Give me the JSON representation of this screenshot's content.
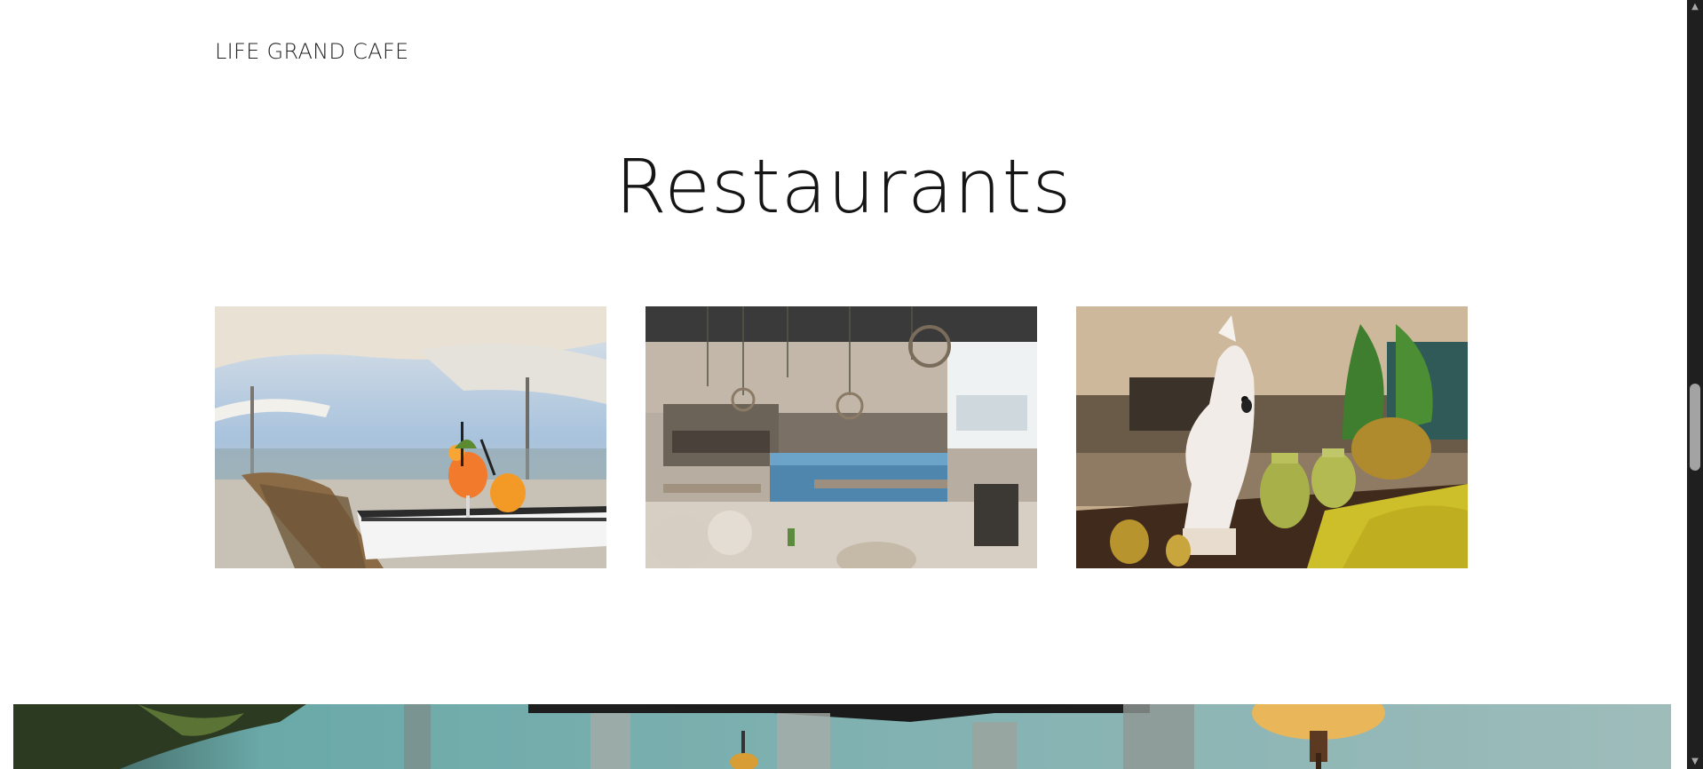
{
  "header": {
    "brand": "LIFE GRAND CAFE"
  },
  "section": {
    "title": "Restaurants"
  },
  "gallery": {
    "items": [
      {
        "alt": "Outdoor terrace with umbrellas and orange cocktails"
      },
      {
        "alt": "Restaurant interior with blue tufted booths and pendant lights"
      },
      {
        "alt": "Lounge with white cockatoo sculpture, green vases and yellow sofa"
      }
    ]
  },
  "banner": {
    "alt": "Cafe interior banner with pendant lamp and curtains"
  },
  "scrollbar": {
    "up_glyph": "▲",
    "down_glyph": "▼",
    "position": 0.5
  }
}
